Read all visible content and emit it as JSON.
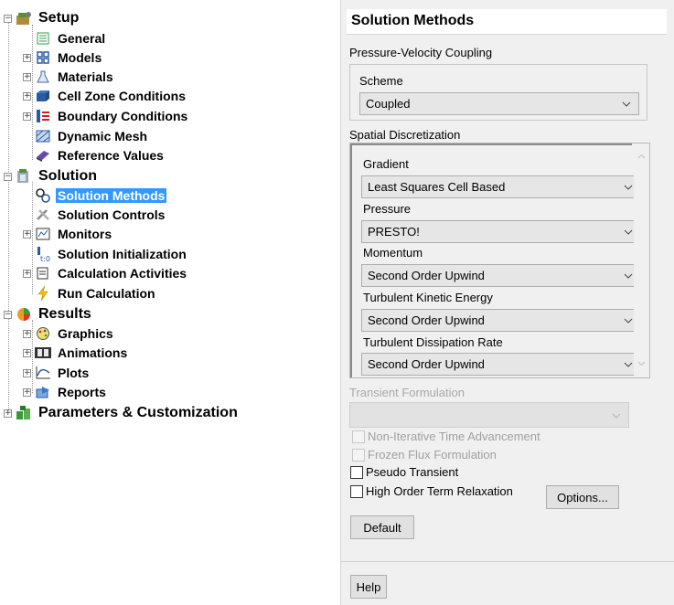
{
  "tree": {
    "setup": {
      "label": "Setup",
      "icon": "setup-icon"
    },
    "setup_children": [
      {
        "label": "General",
        "icon": "general-icon",
        "expandable": false
      },
      {
        "label": "Models",
        "icon": "models-icon",
        "expandable": true
      },
      {
        "label": "Materials",
        "icon": "materials-icon",
        "expandable": true
      },
      {
        "label": "Cell Zone Conditions",
        "icon": "cell-zone-icon",
        "expandable": true
      },
      {
        "label": "Boundary Conditions",
        "icon": "boundary-icon",
        "expandable": true
      },
      {
        "label": "Dynamic Mesh",
        "icon": "dynamic-mesh-icon",
        "expandable": false
      },
      {
        "label": "Reference Values",
        "icon": "reference-values-icon",
        "expandable": false
      }
    ],
    "solution": {
      "label": "Solution",
      "icon": "solution-icon"
    },
    "solution_children": [
      {
        "label": "Solution Methods",
        "icon": "solution-methods-icon",
        "expandable": false,
        "selected": true
      },
      {
        "label": "Solution Controls",
        "icon": "solution-controls-icon",
        "expandable": false
      },
      {
        "label": "Monitors",
        "icon": "monitors-icon",
        "expandable": true
      },
      {
        "label": "Solution Initialization",
        "icon": "initialization-icon",
        "expandable": false
      },
      {
        "label": "Calculation Activities",
        "icon": "calculation-activities-icon",
        "expandable": true
      },
      {
        "label": "Run Calculation",
        "icon": "run-calculation-icon",
        "expandable": false
      }
    ],
    "results": {
      "label": "Results",
      "icon": "results-icon"
    },
    "results_children": [
      {
        "label": "Graphics",
        "icon": "graphics-icon",
        "expandable": true
      },
      {
        "label": "Animations",
        "icon": "animations-icon",
        "expandable": true
      },
      {
        "label": "Plots",
        "icon": "plots-icon",
        "expandable": true
      },
      {
        "label": "Reports",
        "icon": "reports-icon",
        "expandable": true
      }
    ],
    "parameters": {
      "label": "Parameters & Customization",
      "icon": "parameters-icon"
    }
  },
  "panel": {
    "title": "Solution Methods",
    "pv_coupling": {
      "group_label": "Pressure-Velocity Coupling",
      "scheme_label": "Scheme",
      "scheme_value": "Coupled"
    },
    "spatial": {
      "group_label": "Spatial Discretization",
      "gradient_label": "Gradient",
      "gradient_value": "Least Squares Cell Based",
      "pressure_label": "Pressure",
      "pressure_value": "PRESTO!",
      "momentum_label": "Momentum",
      "momentum_value": "Second Order Upwind",
      "tke_label": "Turbulent Kinetic Energy",
      "tke_value": "Second Order Upwind",
      "tdr_label": "Turbulent Dissipation Rate",
      "tdr_value": "Second Order Upwind"
    },
    "transient": {
      "group_label": "Transient Formulation",
      "value": ""
    },
    "checkboxes": {
      "non_iterative": {
        "label": "Non-Iterative Time Advancement",
        "checked": false,
        "enabled": false
      },
      "frozen_flux": {
        "label": "Frozen Flux Formulation",
        "checked": false,
        "enabled": false
      },
      "pseudo_transient": {
        "label": "Pseudo Transient",
        "checked": false,
        "enabled": true
      },
      "high_order": {
        "label": "High Order Term Relaxation",
        "checked": false,
        "enabled": true
      }
    },
    "buttons": {
      "options": "Options...",
      "default": "Default",
      "help": "Help"
    }
  },
  "colors": {
    "selection": "#3399ff",
    "panel_bg": "#f0f0f0",
    "combo_bg": "#e6e6e6",
    "disabled_text": "#a0a0a0"
  }
}
